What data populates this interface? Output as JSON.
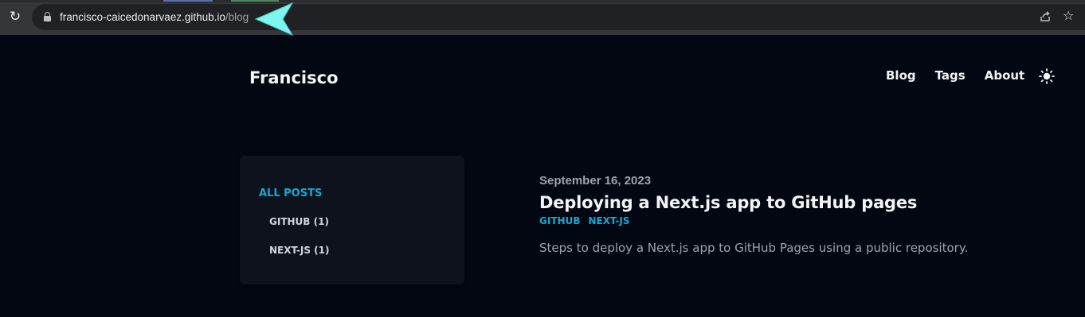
{
  "browser": {
    "url_host": "francisco-caicedonarvaez.github.io",
    "url_path": "/blog",
    "reload_icon": "reload-icon",
    "lock_icon": "lock-icon",
    "share_icon": "share-icon",
    "star_icon": "star-icon",
    "star_glyph": "☆",
    "reload_glyph": "↻"
  },
  "header": {
    "site_title": "Francisco",
    "nav": [
      "Blog",
      "Tags",
      "About"
    ],
    "theme_icon": "sun-icon"
  },
  "sidebar": {
    "all_posts": "ALL POSTS",
    "tags": [
      {
        "label": "GITHUB (1)"
      },
      {
        "label": "NEXT-JS (1)"
      }
    ]
  },
  "post": {
    "date": "September 16, 2023",
    "title": "Deploying a Next.js app to GitHub pages",
    "tags": [
      "GITHUB",
      "NEXT-JS"
    ],
    "summary": "Steps to deploy a Next.js app to GitHub Pages using a public repository."
  },
  "colors": {
    "background": "#030712",
    "accent": "#14a8d6",
    "sidebar_bg": "#0e121d"
  }
}
